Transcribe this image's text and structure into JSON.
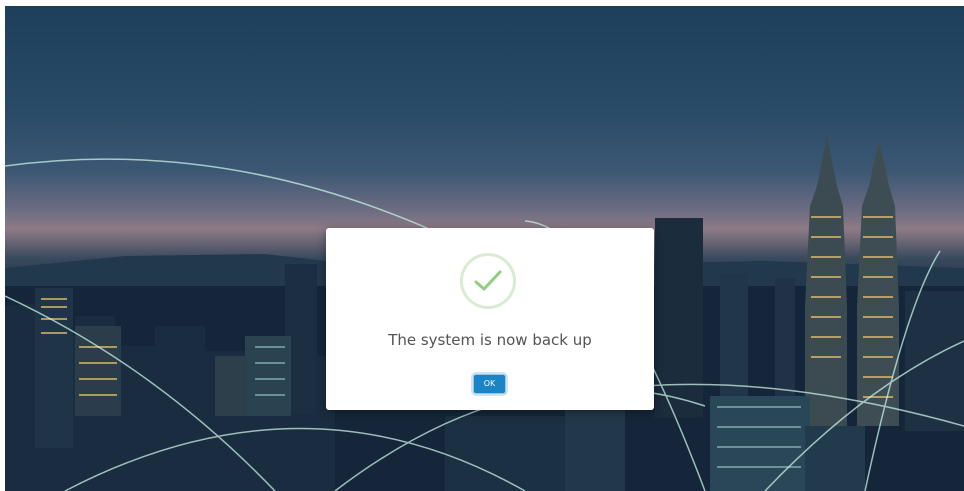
{
  "dialog": {
    "message": "The system is now back up",
    "ok_label": "OK",
    "icon": "checkmark-icon",
    "accent_color": "#1a84c7",
    "success_color": "#8dcf7c"
  },
  "background": {
    "description_icon": "city-skyline-backdrop"
  }
}
